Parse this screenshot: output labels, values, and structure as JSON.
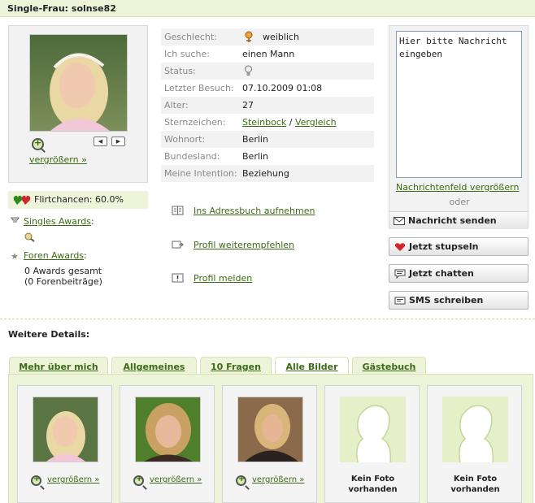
{
  "header": {
    "title": "Single-Frau: solnse82"
  },
  "profile": {
    "zoom_label": "vergrößern »",
    "pager_prev": "◀",
    "pager_next": "▶",
    "flirt_label": "Flirtchancen: 60.0%",
    "singles_awards": "Singles Awards",
    "foren_awards": "Foren Awards",
    "awards_total": "0 Awards gesamt",
    "forum_posts": "(0 Forenbeiträge)"
  },
  "info": {
    "rows": [
      {
        "key": "Geschlecht:",
        "value": "weiblich"
      },
      {
        "key": "Ich suche:",
        "value": "einen Mann"
      },
      {
        "key": "Status:",
        "value": ""
      },
      {
        "key": "Letzter Besuch:",
        "value": "07.10.2009 01:08"
      },
      {
        "key": "Alter:",
        "value": "27"
      },
      {
        "key": "Sternzeichen:",
        "value": "Steinbock",
        "value2": "Vergleich"
      },
      {
        "key": "Wohnort:",
        "value": "Berlin"
      },
      {
        "key": "Bundesland:",
        "value": "Berlin"
      },
      {
        "key": "Meine Intention:",
        "value": "Beziehung"
      }
    ],
    "star_sep": "/"
  },
  "actions": {
    "addressbook": "Ins Adressbuch aufnehmen",
    "recommend": "Profil weiterempfehlen",
    "report": "Profil melden"
  },
  "message": {
    "placeholder": "Hier bitte Nachricht eingeben",
    "enlarge": "Nachrichtenfeld vergrößern",
    "or": "oder",
    "send": "Nachricht senden"
  },
  "buttons": {
    "stupsen": "Jetzt stupseln",
    "chat": "Jetzt chatten",
    "sms": "SMS schreiben"
  },
  "details": {
    "title": "Weitere Details:",
    "tabs": [
      "Mehr über mich",
      "Allgemeines",
      "10 Fragen",
      "Alle Bilder",
      "Gästebuch"
    ],
    "active_tab": "Alle Bilder",
    "zoom_label": "vergrößern »",
    "no_photo": "Kein Foto vorhanden"
  },
  "colors": {
    "accent_green": "#3b6b12",
    "header_bg": "#eef4d9"
  }
}
